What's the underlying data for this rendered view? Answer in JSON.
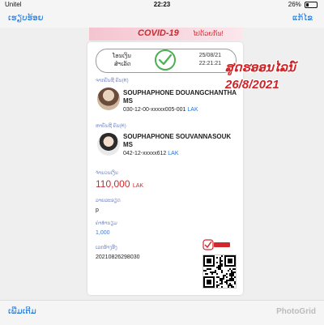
{
  "status_bar": {
    "carrier": "Unitel",
    "time": "22:23",
    "battery": "26%"
  },
  "nav": {
    "done_label": "ເຮຽບຮ້ອຍ",
    "edit_label": "ແກ້ໄຂ"
  },
  "banner": {
    "text": "COVID-19",
    "sub": "ໄປດ້ວຍກັນ!"
  },
  "result": {
    "status_line1": "ໂອນເງິນ",
    "status_line2": "ສຳເລັດ",
    "date": "25/08/21",
    "time": "22:21:21"
  },
  "sender": {
    "label": "ຈາກບັນຊີ ຄົນ(₭)",
    "name": "SOUPHAPHONE DOUANGCHANTHA MS",
    "account": "030-12-00-xxxxx005-001",
    "currency": "LAK"
  },
  "receiver": {
    "label": "ຫາບັນຊີ ຄົນ(₭)",
    "name": "SOUPHAPHONE SOUVANNASOUK MS",
    "account": "042-12-xxxxx612",
    "currency": "LAK"
  },
  "amount": {
    "label": "ຈຳນວນເງິນ",
    "value": "110,000",
    "currency": "LAK"
  },
  "memo": {
    "label": "ລາຍລະອຽດ",
    "value": "p"
  },
  "fee": {
    "label": "ຄ່າທຳນຽມ",
    "value": "1,000"
  },
  "ref": {
    "label": "ເລກອ້າງອີງ",
    "value": "20210826298030"
  },
  "overlay": {
    "line1": "ສູດຮອອນໄລນ໌",
    "line2": "26/8/2021"
  },
  "bottom": {
    "more_label": "ເພີ່ມເຕີມ",
    "watermark": "PhotoGrid"
  },
  "colors": {
    "accent": "#1a73d9",
    "amount": "#d1282e",
    "check": "#4caf50"
  }
}
